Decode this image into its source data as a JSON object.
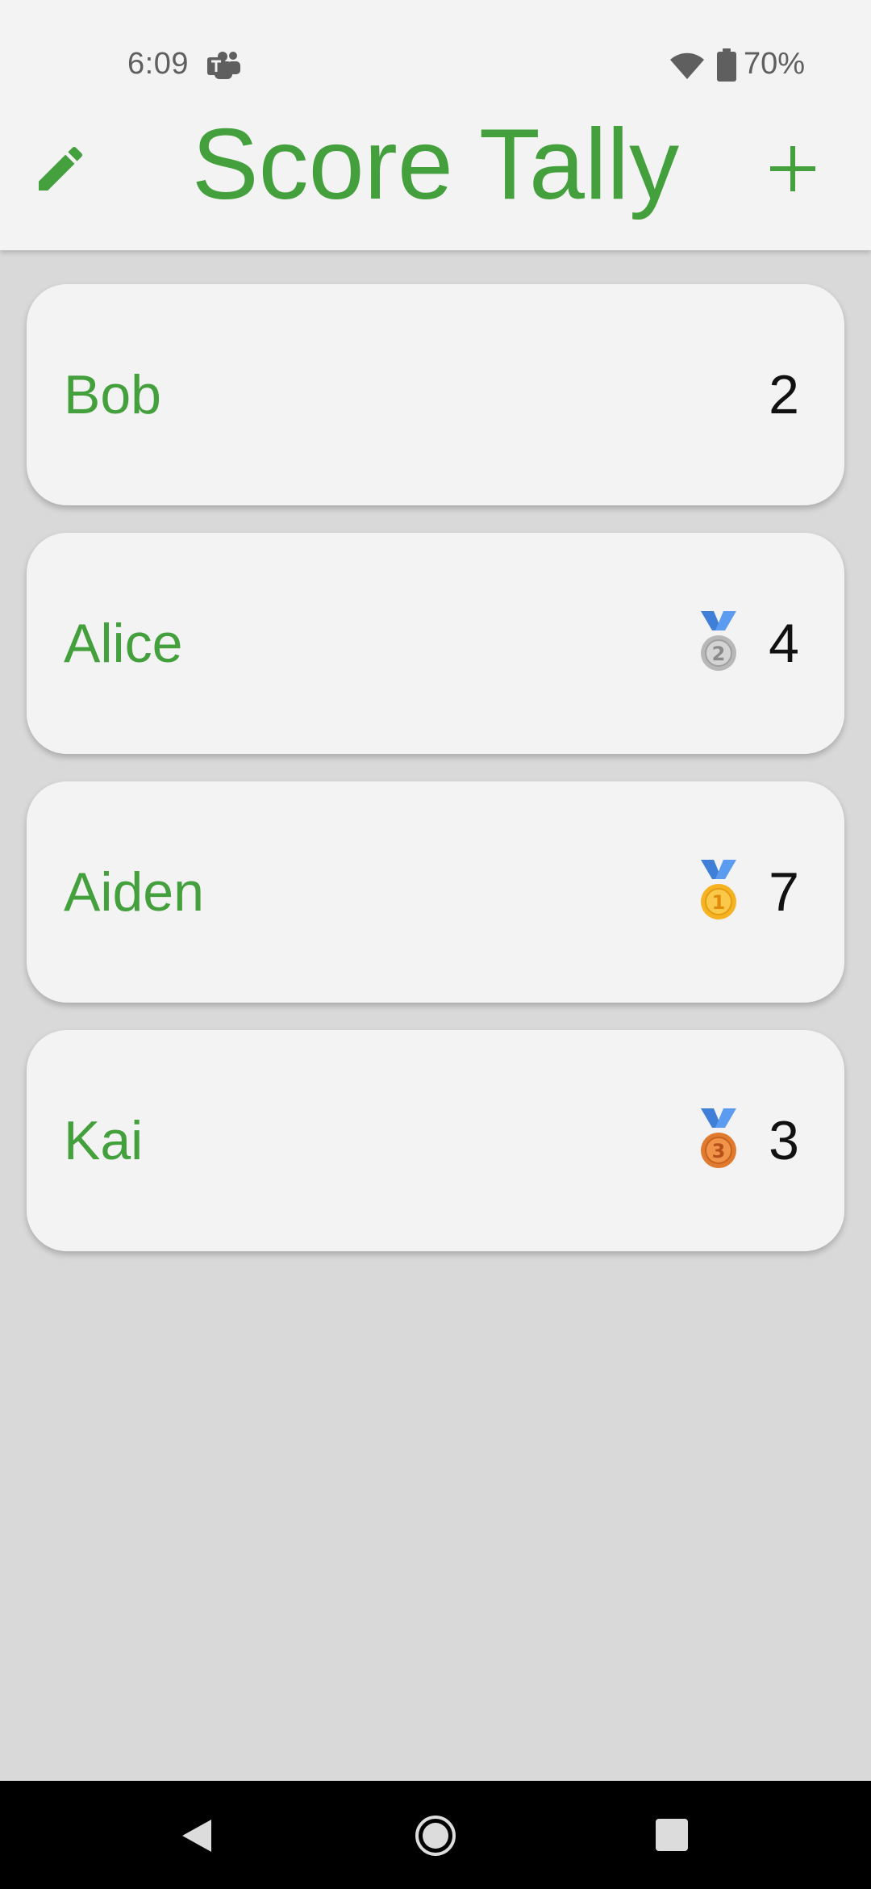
{
  "status_bar": {
    "time": "6:09",
    "battery": "70%",
    "icons": [
      "teams-icon",
      "wifi-icon",
      "battery-icon"
    ]
  },
  "app_bar": {
    "title": "Score Tally",
    "left_action": "edit-icon",
    "right_action": "add-icon"
  },
  "players": [
    {
      "name": "Bob",
      "score": "2",
      "medal": null
    },
    {
      "name": "Alice",
      "score": "4",
      "medal": "2"
    },
    {
      "name": "Aiden",
      "score": "7",
      "medal": "1"
    },
    {
      "name": "Kai",
      "score": "3",
      "medal": "3"
    }
  ],
  "nav_bar": {
    "icons": [
      "back-icon",
      "home-icon",
      "recents-icon"
    ]
  },
  "colors": {
    "accent": "#43a03c",
    "card": "#f3f3f3",
    "background": "#d9d9d9",
    "gold": "#f5b323",
    "silver": "#b8b8b8",
    "bronze": "#e07a2e",
    "ribbon": "#4a8be0"
  }
}
